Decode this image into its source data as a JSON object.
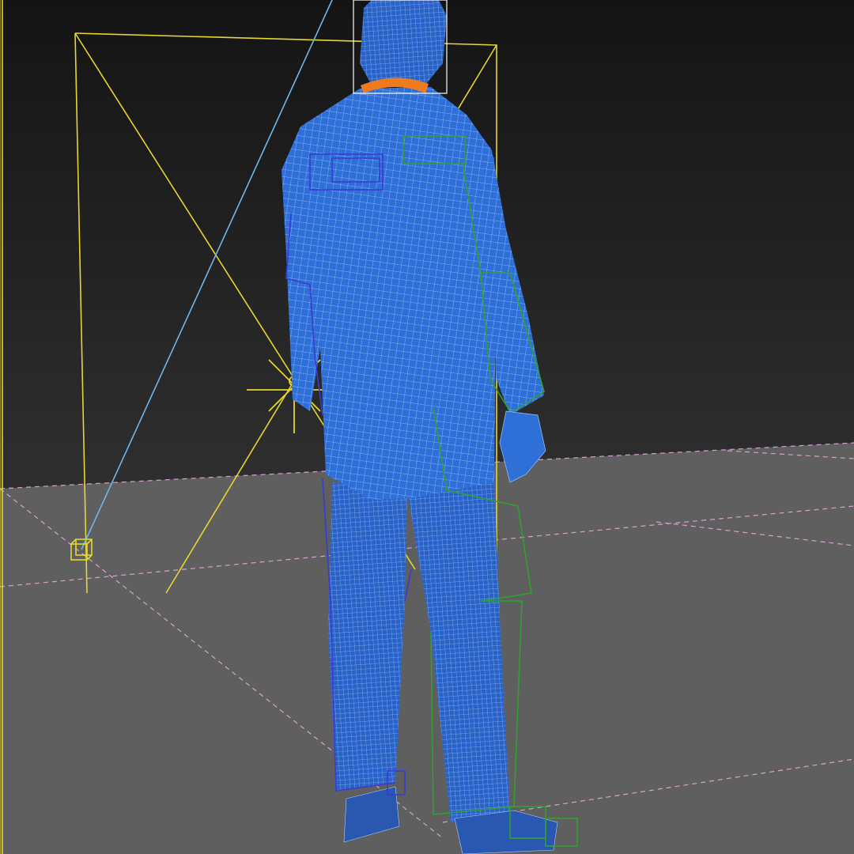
{
  "viewport": {
    "type": "3d-perspective-viewport",
    "shading": "wireframe-over-shaded",
    "background_gradient": [
      "#141414",
      "#2e2e2e",
      "#3a3a3a"
    ],
    "ground_color": "#5f5f5f"
  },
  "scene": {
    "grid": {
      "visible": true,
      "color": "#e7a8e0",
      "style": "dashed"
    },
    "colors": {
      "character_mesh": "#2f6fd8",
      "mesh_wire": "#9cc3ff",
      "camera_frustum": "#e6d532",
      "camera_target_line": "#6fb7ea",
      "light_gizmo": "#e6d532",
      "bone_left": "#3b3bd4",
      "bone_right": "#2fa12f",
      "collar": "#f07b1f",
      "selection_bbox": "#ffffff"
    },
    "objects": [
      {
        "kind": "character",
        "icon": "human-figure"
      },
      {
        "kind": "camera",
        "icon": "camera-frustum"
      },
      {
        "kind": "light",
        "icon": "omni-light"
      },
      {
        "kind": "biped-skeleton",
        "icon": "bone-rig"
      }
    ]
  }
}
